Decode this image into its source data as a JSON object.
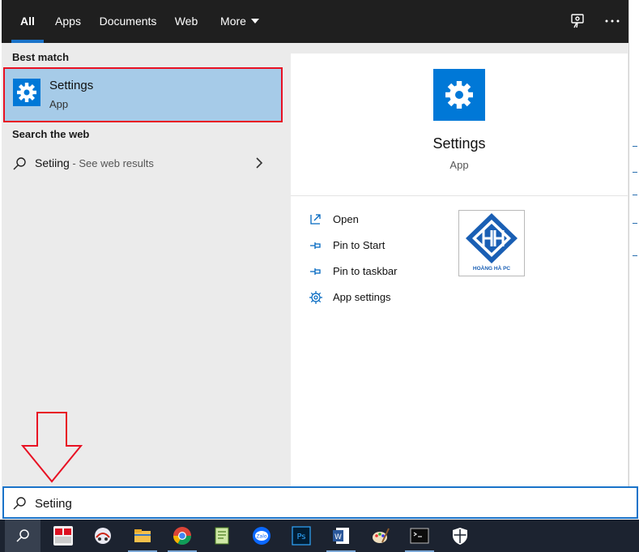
{
  "tabs": [
    {
      "label": "All"
    },
    {
      "label": "Apps"
    },
    {
      "label": "Documents"
    },
    {
      "label": "Web"
    },
    {
      "label": "More"
    }
  ],
  "top_icons": [
    "feedback-icon",
    "more-options-icon"
  ],
  "best_match": {
    "section_label": "Best match",
    "name": "Settings",
    "type": "App",
    "icon": "gear-icon"
  },
  "web": {
    "section_label": "Search the web",
    "query": "Setiing",
    "suffix": " - See web results"
  },
  "detail": {
    "name": "Settings",
    "type": "App",
    "actions": [
      {
        "label": "Open",
        "icon": "open-icon"
      },
      {
        "label": "Pin to Start",
        "icon": "pin-icon"
      },
      {
        "label": "Pin to taskbar",
        "icon": "pin-icon"
      },
      {
        "label": "App settings",
        "icon": "gear-icon"
      }
    ],
    "logo_text": "HOÀNG HÀ PC"
  },
  "search": {
    "value": "Setiing"
  },
  "taskbar": {
    "items": [
      "search-icon",
      "unikey-icon",
      "snipping-tool-icon",
      "file-explorer-icon",
      "chrome-icon",
      "notepad-icon",
      "zalo-icon",
      "photoshop-icon",
      "word-icon",
      "paint-icon",
      "terminal-icon",
      "shield-icon"
    ]
  },
  "colors": {
    "accent": "#0078d7",
    "highlight": "#a6cbe8",
    "annotation_red": "#e81123",
    "topbar": "#1f1f1f",
    "taskbar": "#1c2330"
  }
}
